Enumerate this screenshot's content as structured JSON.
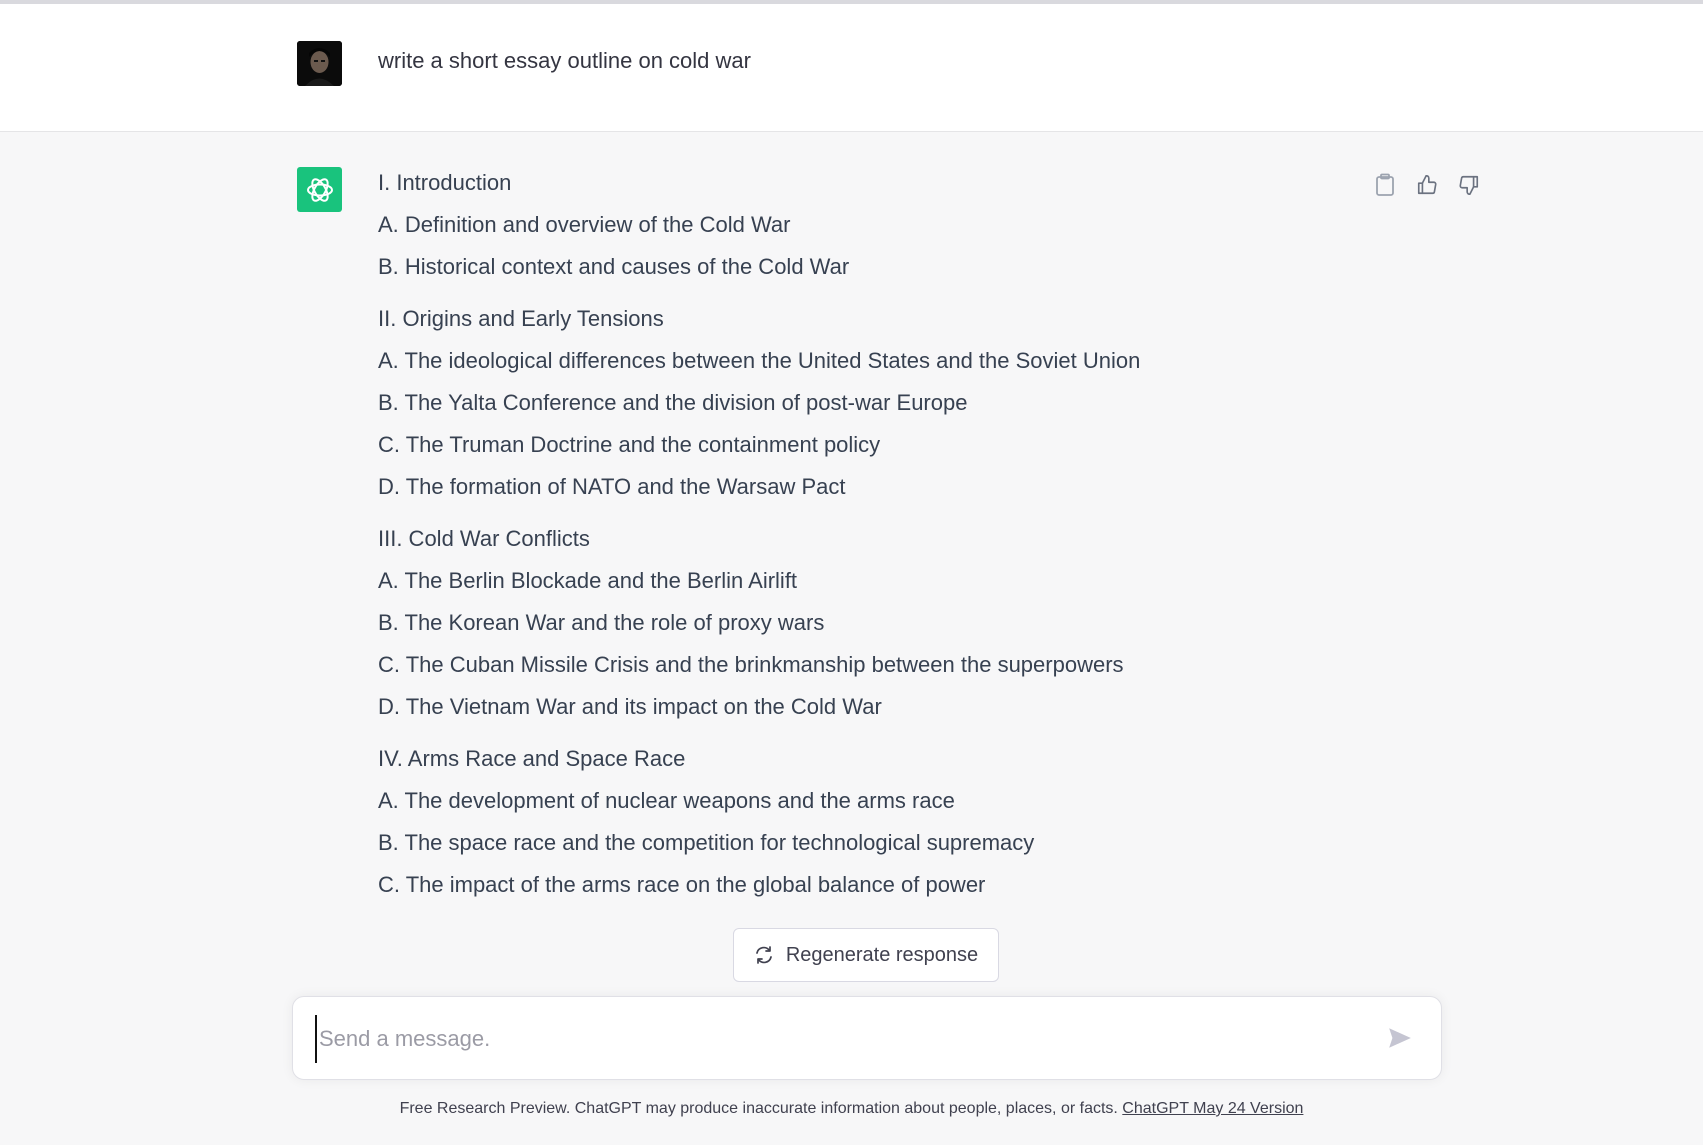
{
  "user_message": {
    "text": "write a short essay outline on cold war",
    "avatar_icon": "user-avatar"
  },
  "assistant_message": {
    "logo_icon": "chatgpt-logo-icon",
    "actions": [
      {
        "name": "copy-button",
        "icon": "clipboard-icon"
      },
      {
        "name": "thumbs-up-button",
        "icon": "thumbs-up-icon"
      },
      {
        "name": "thumbs-down-button",
        "icon": "thumbs-down-icon"
      }
    ],
    "sections": [
      {
        "heading": "I. Introduction",
        "items": [
          "A. Definition and overview of the Cold War",
          "B. Historical context and causes of the Cold War"
        ]
      },
      {
        "heading": "II. Origins and Early Tensions",
        "items": [
          "A. The ideological differences between the United States and the Soviet Union",
          "B. The Yalta Conference and the division of post-war Europe",
          "C. The Truman Doctrine and the containment policy",
          "D. The formation of NATO and the Warsaw Pact"
        ]
      },
      {
        "heading": "III. Cold War Conflicts",
        "items": [
          "A. The Berlin Blockade and the Berlin Airlift",
          "B. The Korean War and the role of proxy wars",
          "C. The Cuban Missile Crisis and the brinkmanship between the superpowers",
          "D. The Vietnam War and its impact on the Cold War"
        ]
      },
      {
        "heading": "IV. Arms Race and Space Race",
        "items": [
          "A. The development of nuclear weapons and the arms race",
          "B. The space race and the competition for technological supremacy",
          "C. The impact of the arms race on the global balance of power"
        ]
      }
    ]
  },
  "regenerate": {
    "label": "Regenerate response",
    "icon": "refresh-icon"
  },
  "composer": {
    "placeholder": "Send a message.",
    "value": "",
    "send_icon": "send-icon"
  },
  "footer": {
    "text": "Free Research Preview. ChatGPT may produce inaccurate information about people, places, or facts. ",
    "link": "ChatGPT May 24 Version"
  },
  "colors": {
    "accent": "#19c37d",
    "assistant_bg": "#f7f7f8",
    "text": "#374151"
  }
}
